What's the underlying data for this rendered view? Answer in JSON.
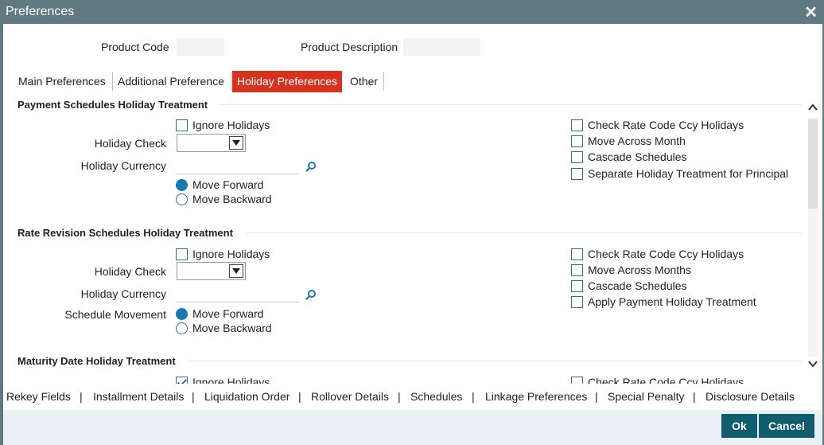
{
  "window": {
    "title": "Preferences",
    "close_glyph": "✕"
  },
  "header": {
    "product_code_label": "Product Code",
    "product_code_value": "",
    "product_description_label": "Product Description",
    "product_description_value": ""
  },
  "tabs": [
    {
      "label": "Main Preferences",
      "active": false
    },
    {
      "label": "Additional Preference",
      "active": false
    },
    {
      "label": "Holiday Preferences",
      "active": true
    },
    {
      "label": "Other",
      "active": false
    }
  ],
  "payment": {
    "title": "Payment Schedules Holiday Treatment",
    "ignore_holidays": {
      "label": "Ignore Holidays",
      "checked": false
    },
    "holiday_check_label": "Holiday Check",
    "holiday_check_value": "",
    "holiday_currency_label": "Holiday Currency",
    "holiday_currency_value": "",
    "move_forward": {
      "label": "Move Forward",
      "selected": true
    },
    "move_backward": {
      "label": "Move Backward",
      "selected": false
    },
    "right": [
      {
        "label": "Check Rate Code Ccy Holidays",
        "checked": false
      },
      {
        "label": "Move Across Month",
        "checked": false
      },
      {
        "label": "Cascade Schedules",
        "checked": false
      },
      {
        "label": "Separate Holiday Treatment for Principal",
        "checked": false
      }
    ]
  },
  "rate": {
    "title": "Rate Revision Schedules Holiday Treatment",
    "ignore_holidays": {
      "label": "Ignore Holidays",
      "checked": false
    },
    "holiday_check_label": "Holiday Check",
    "holiday_check_value": "",
    "holiday_currency_label": "Holiday Currency",
    "holiday_currency_value": "",
    "schedule_movement_label": "Schedule Movement",
    "move_forward": {
      "label": "Move Forward",
      "selected": true
    },
    "move_backward": {
      "label": "Move Backward",
      "selected": false
    },
    "right": [
      {
        "label": "Check Rate Code Ccy Holidays",
        "checked": false
      },
      {
        "label": "Move Across Months",
        "checked": false
      },
      {
        "label": "Cascade Schedules",
        "checked": false
      },
      {
        "label": "Apply Payment Holiday Treatment",
        "checked": false
      }
    ]
  },
  "maturity": {
    "title": "Maturity Date Holiday Treatment",
    "ignore_holidays": {
      "label": "Ignore Holidays",
      "checked": true
    },
    "right": [
      {
        "label": "Check Rate Code Ccy Holidays",
        "checked": false
      }
    ]
  },
  "bottom_links": [
    "Rekey Fields",
    "Installment Details",
    "Liquidation Order",
    "Rollover Details",
    "Schedules",
    "Linkage Preferences",
    "Special Penalty",
    "Disclosure Details"
  ],
  "bottom_separator": "|",
  "buttons": {
    "ok": "Ok",
    "cancel": "Cancel"
  },
  "icons": {
    "search": "search-icon",
    "close": "close-icon",
    "dropdown": "chevron-down-icon"
  },
  "colors": {
    "titlebar": "#5f7a80",
    "active_tab": "#d6321e",
    "button": "#0f5d6d",
    "footer": "#e9f1f4",
    "radio_selected": "#1b77b0"
  }
}
